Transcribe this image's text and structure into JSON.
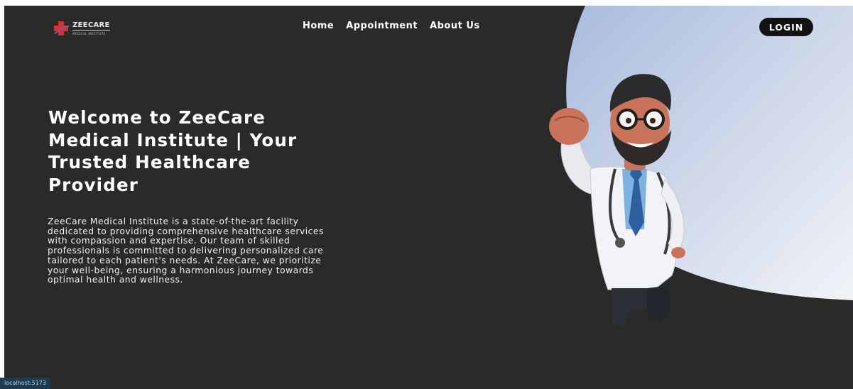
{
  "logo": {
    "name": "ZEECARE",
    "subtitle": "MEDICAL INSTITUTE"
  },
  "nav": {
    "items": [
      "Home",
      "Appointment",
      "About Us"
    ],
    "login_label": "LOGIN"
  },
  "hero": {
    "title": "Welcome to ZeeCare Medical Institute | Your Trusted Healthcare Provider",
    "description": "ZeeCare Medical Institute is a state-of-the-art facility dedicated to providing comprehensive healthcare services with compassion and expertise. Our team of skilled professionals is committed to delivering personalized care tailored to each patient's needs. At ZeeCare, we prioritize your well-being, ensuring a harmonious journey towards optimal health and wellness."
  },
  "status_bar": {
    "url": "localhost:5173"
  },
  "colors": {
    "background": "#2a2a2a",
    "accent_gradient_start": "#a9bcdd",
    "accent_gradient_end": "#f1f3f7",
    "login_bg": "#121212",
    "logo_red": "#d9322f",
    "logo_purple": "#6a5fb8"
  },
  "icons": {
    "logo": "medical-cross-icon",
    "illustration": "doctor-illustration"
  }
}
